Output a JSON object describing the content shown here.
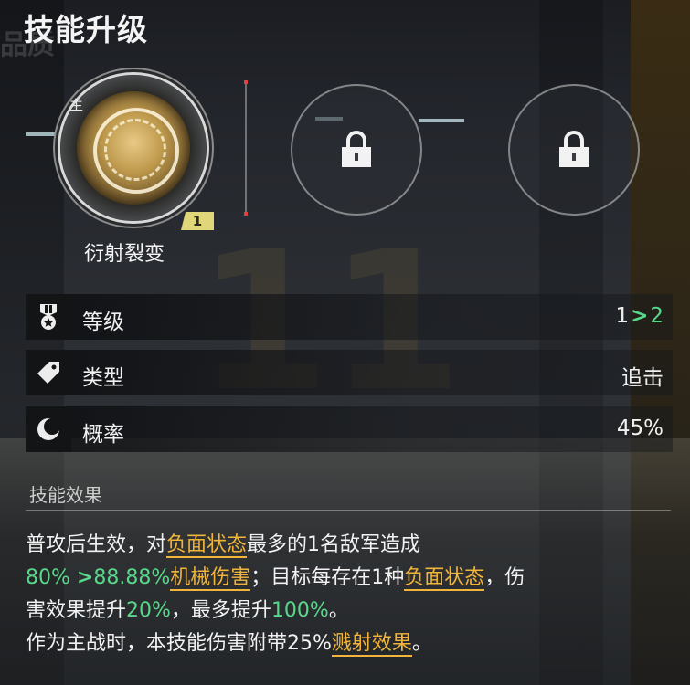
{
  "header": {
    "title": "技能升级",
    "ghost_text": "品质"
  },
  "skills": {
    "main_tag": "主",
    "main_skill_name": "衍射裂变",
    "main_skill_level": "1",
    "locked_slots": 2
  },
  "stats": [
    {
      "icon": "medal-icon",
      "label": "等级",
      "from": "1",
      "to": "2"
    },
    {
      "icon": "tag-icon",
      "label": "类型",
      "value": "追击"
    },
    {
      "icon": "moon-icon",
      "label": "概率",
      "value": "45%"
    }
  ],
  "effect": {
    "heading": "技能效果",
    "line1": {
      "a": "普攻后生效，对",
      "b": "负面状态",
      "c": "最多的1名敌军造成"
    },
    "line2": {
      "a": "80% ",
      "b": "88.88%",
      "c": "机械伤害",
      "d": "；目标每存在1种",
      "e": "负面状态",
      "f": "，伤"
    },
    "line3": {
      "a": "害效果提升",
      "b": "20%",
      "c": "，最多提升",
      "d": "100%",
      "e": "。"
    },
    "line4": {
      "a": "作为主战时，本技能伤害附带25%",
      "b": "溅射效果",
      "c": "。"
    }
  },
  "colors": {
    "accent_green": "#59d88c",
    "highlight_orange": "#f1b53b",
    "level_badge": "#e0d77a"
  }
}
